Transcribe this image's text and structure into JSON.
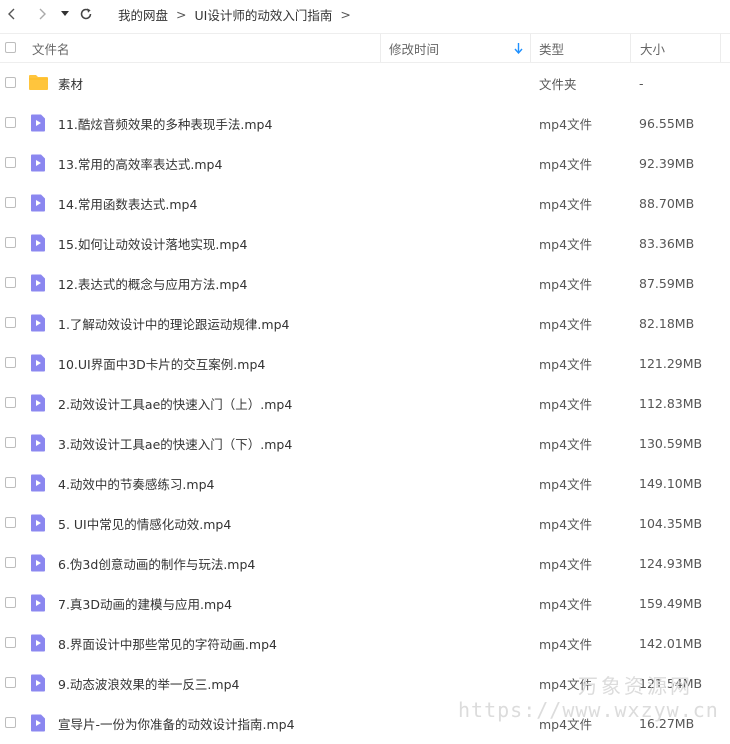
{
  "breadcrumb": {
    "root": "我的网盘",
    "sep1": ">",
    "current": "UI设计师的动效入门指南",
    "sep2": ">"
  },
  "columns": {
    "name": "文件名",
    "modified": "修改时间",
    "type": "类型",
    "size": "大小"
  },
  "colors": {
    "folder": "#ffc53d",
    "video_icon": "#8b87f0"
  },
  "files": [
    {
      "name": "素材",
      "type": "文件夹",
      "size": "-",
      "kind": "folder"
    },
    {
      "name": "11.酷炫音频效果的多种表现手法.mp4",
      "type": "mp4文件",
      "size": "96.55MB",
      "kind": "video"
    },
    {
      "name": "13.常用的高效率表达式.mp4",
      "type": "mp4文件",
      "size": "92.39MB",
      "kind": "video"
    },
    {
      "name": "14.常用函数表达式.mp4",
      "type": "mp4文件",
      "size": "88.70MB",
      "kind": "video"
    },
    {
      "name": "15.如何让动效设计落地实现.mp4",
      "type": "mp4文件",
      "size": "83.36MB",
      "kind": "video"
    },
    {
      "name": "12.表达式的概念与应用方法.mp4",
      "type": "mp4文件",
      "size": "87.59MB",
      "kind": "video"
    },
    {
      "name": "1.了解动效设计中的理论跟运动规律.mp4",
      "type": "mp4文件",
      "size": "82.18MB",
      "kind": "video"
    },
    {
      "name": "10.UI界面中3D卡片的交互案例.mp4",
      "type": "mp4文件",
      "size": "121.29MB",
      "kind": "video"
    },
    {
      "name": "2.动效设计工具ae的快速入门（上）.mp4",
      "type": "mp4文件",
      "size": "112.83MB",
      "kind": "video"
    },
    {
      "name": "3.动效设计工具ae的快速入门（下）.mp4",
      "type": "mp4文件",
      "size": "130.59MB",
      "kind": "video"
    },
    {
      "name": "4.动效中的节奏感练习.mp4",
      "type": "mp4文件",
      "size": "149.10MB",
      "kind": "video"
    },
    {
      "name": "5. UI中常见的情感化动效.mp4",
      "type": "mp4文件",
      "size": "104.35MB",
      "kind": "video"
    },
    {
      "name": "6.伪3d创意动画的制作与玩法.mp4",
      "type": "mp4文件",
      "size": "124.93MB",
      "kind": "video"
    },
    {
      "name": "7.真3D动画的建模与应用.mp4",
      "type": "mp4文件",
      "size": "159.49MB",
      "kind": "video"
    },
    {
      "name": "8.界面设计中那些常见的字符动画.mp4",
      "type": "mp4文件",
      "size": "142.01MB",
      "kind": "video"
    },
    {
      "name": "9.动态波浪效果的举一反三.mp4",
      "type": "mp4文件",
      "size": "121.54MB",
      "kind": "video"
    },
    {
      "name": "宣导片-一份为你准备的动效设计指南.mp4",
      "type": "mp4文件",
      "size": "16.27MB",
      "kind": "video"
    }
  ],
  "watermark": {
    "logo": "万象资源网",
    "url": "https://www.wxzyw.cn"
  }
}
